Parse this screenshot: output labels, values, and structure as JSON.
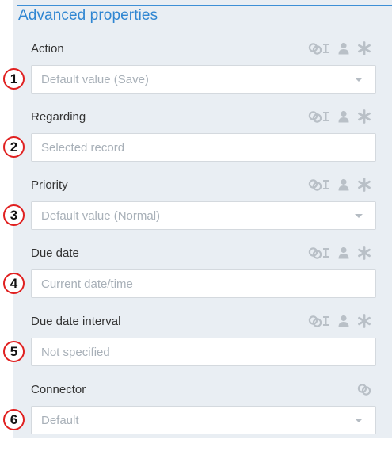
{
  "section": {
    "title": "Advanced properties"
  },
  "fields": [
    {
      "number": "1",
      "label": "Action",
      "value": "Default value (Save)",
      "type": "select",
      "icons": [
        "link-text-icon",
        "user-icon",
        "asterisk-icon"
      ]
    },
    {
      "number": "2",
      "label": "Regarding",
      "value": "Selected record",
      "type": "text",
      "icons": [
        "link-text-icon",
        "user-icon",
        "asterisk-icon"
      ]
    },
    {
      "number": "3",
      "label": "Priority",
      "value": "Default value (Normal)",
      "type": "select",
      "icons": [
        "link-text-icon",
        "user-icon",
        "asterisk-icon"
      ]
    },
    {
      "number": "4",
      "label": "Due date",
      "value": "Current date/time",
      "type": "text",
      "icons": [
        "link-text-icon",
        "user-icon",
        "asterisk-icon"
      ]
    },
    {
      "number": "5",
      "label": "Due date interval",
      "value": "Not specified",
      "type": "text",
      "icons": [
        "link-text-icon",
        "user-icon",
        "asterisk-icon"
      ]
    },
    {
      "number": "6",
      "label": "Connector",
      "value": "Default",
      "type": "select",
      "icons": [
        "link-icon"
      ]
    }
  ],
  "colors": {
    "accent": "#2f86d2",
    "panel_background": "#e9eef3",
    "callout_border": "#e02020",
    "icon": "#b9c0c7",
    "placeholder_text": "#a8b0b8"
  }
}
